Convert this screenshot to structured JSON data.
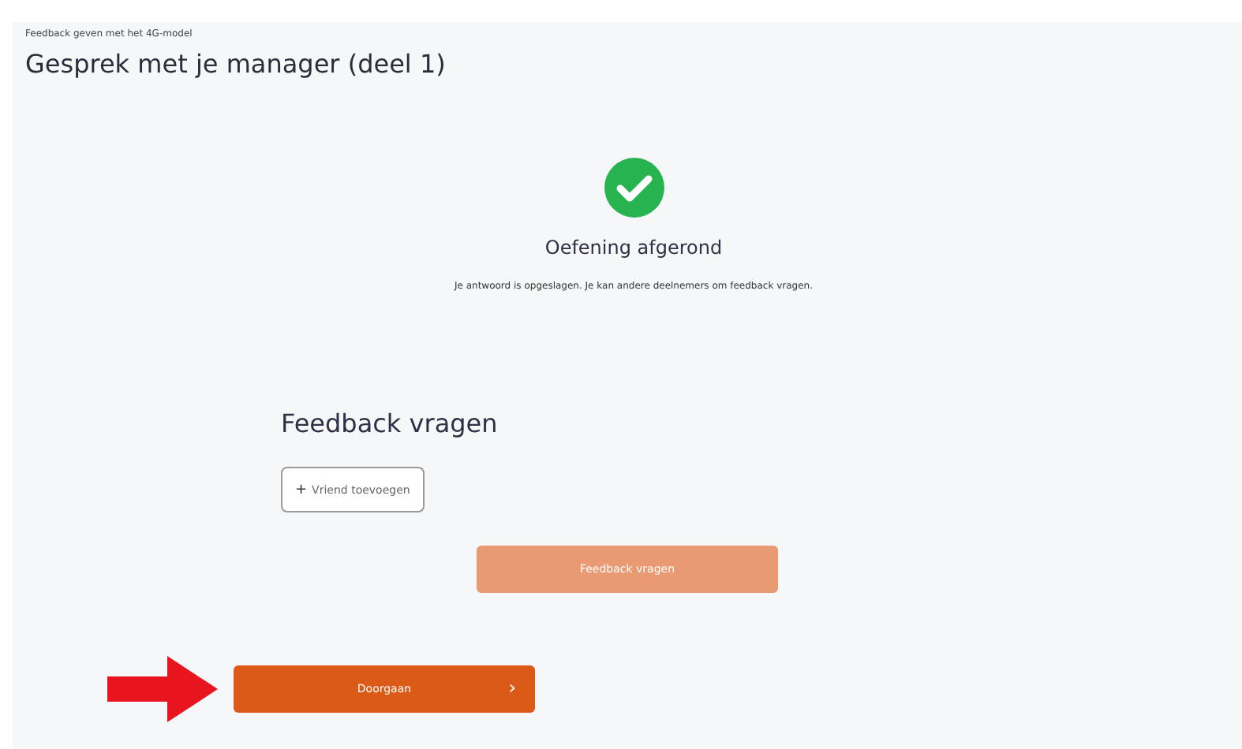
{
  "breadcrumb": "Feedback geven met het 4G-model",
  "title": "Gesprek met je manager (deel 1)",
  "status": {
    "heading": "Oefening afgerond",
    "message": "Je antwoord is opgeslagen. Je kan andere deelnemers om feedback vragen."
  },
  "feedback": {
    "heading": "Feedback vragen",
    "add_button": {
      "icon": "+",
      "label": "Vriend toevoegen"
    },
    "request_button": {
      "label": "Feedback vragen",
      "disabled": true
    }
  },
  "continue_button": {
    "label": "Doorgaan",
    "icon": "›",
    "disabled": false
  }
}
